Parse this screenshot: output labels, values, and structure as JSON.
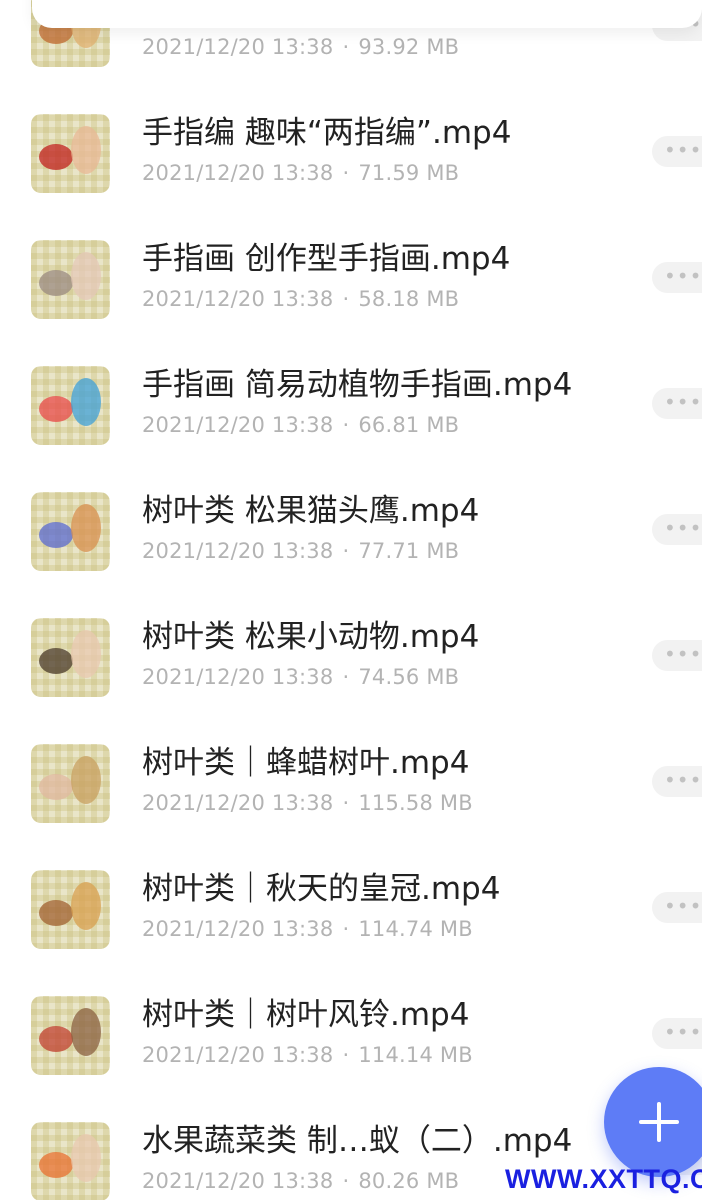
{
  "files": [
    {
      "name": "",
      "date": "2021/12/20 13:38",
      "size": "93.92 MB",
      "thumb": [
        "#c06a30",
        "#e0b070"
      ]
    },
    {
      "name": "手指编  趣味“两指编”.mp4",
      "date": "2021/12/20 13:38",
      "size": "71.59 MB",
      "thumb": [
        "#c0201e",
        "#e8b896"
      ]
    },
    {
      "name": "手指画  创作型手指画.mp4",
      "date": "2021/12/20 13:38",
      "size": "58.18 MB",
      "thumb": [
        "#9a8a80",
        "#e4c8b8"
      ]
    },
    {
      "name": "手指画  简易动植物手指画.mp4",
      "date": "2021/12/20 13:38",
      "size": "66.81 MB",
      "thumb": [
        "#e84a4a",
        "#3fa0d8"
      ]
    },
    {
      "name": "树叶类  松果猫头鹰.mp4",
      "date": "2021/12/20 13:38",
      "size": "77.71 MB",
      "thumb": [
        "#5a6ad0",
        "#d89050"
      ]
    },
    {
      "name": "树叶类  松果小动物.mp4",
      "date": "2021/12/20 13:38",
      "size": "74.56 MB",
      "thumb": [
        "#4a3a2a",
        "#e8c8b0"
      ]
    },
    {
      "name": "树叶类｜蜂蜡树叶.mp4",
      "date": "2021/12/20 13:38",
      "size": "115.58 MB",
      "thumb": [
        "#e0b8a0",
        "#c8a060"
      ]
    },
    {
      "name": "树叶类｜秋天的皇冠.mp4",
      "date": "2021/12/20 13:38",
      "size": "114.74 MB",
      "thumb": [
        "#a06030",
        "#d8a050"
      ]
    },
    {
      "name": "树叶类｜树叶风铃.mp4",
      "date": "2021/12/20 13:38",
      "size": "114.14 MB",
      "thumb": [
        "#c04030",
        "#8a6040"
      ]
    },
    {
      "name": "水果蔬菜类  制…蚁（二）.mp4",
      "date": "2021/12/20 13:38",
      "size": "80.26 MB",
      "thumb": [
        "#e87030",
        "#e8c8b0"
      ]
    }
  ],
  "more_label": "•••",
  "watermark": "WWW.XXTTQ.COM",
  "colors": {
    "accent": "#5e7cf6",
    "meta": "#b3b3b3",
    "watermark": "#1a20e0"
  }
}
